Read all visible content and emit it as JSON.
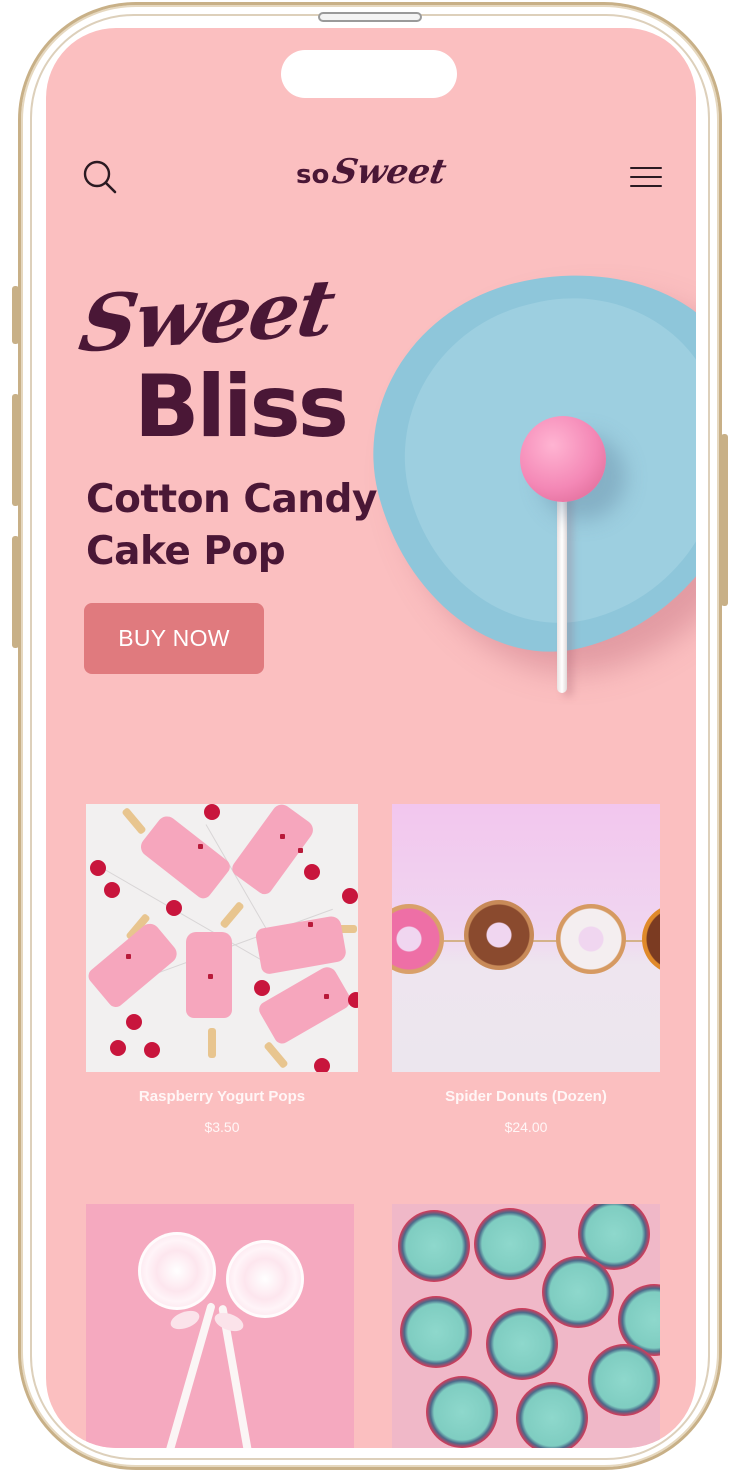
{
  "brand": {
    "logo_prefix": "so",
    "logo_script": "Sweet"
  },
  "header": {
    "search_icon": "search-icon",
    "menu_icon": "hamburger-menu-icon"
  },
  "hero": {
    "script_word": "Sweet",
    "bold_word": "Bliss",
    "product_title": "Cotton Candy Cake Pop",
    "cta_label": "BUY NOW"
  },
  "products": [
    {
      "name": "Raspberry Yogurt Pops",
      "price": "$3.50"
    },
    {
      "name": "Spider Donuts (Dozen)",
      "price": "$24.00"
    },
    {
      "name": "",
      "price": ""
    },
    {
      "name": "",
      "price": ""
    }
  ],
  "colors": {
    "background": "#fbbfc0",
    "brand_text": "#4a1736",
    "cta_button": "#e07a7e",
    "plate": "#8ec6da",
    "frame": "#c8b087"
  }
}
